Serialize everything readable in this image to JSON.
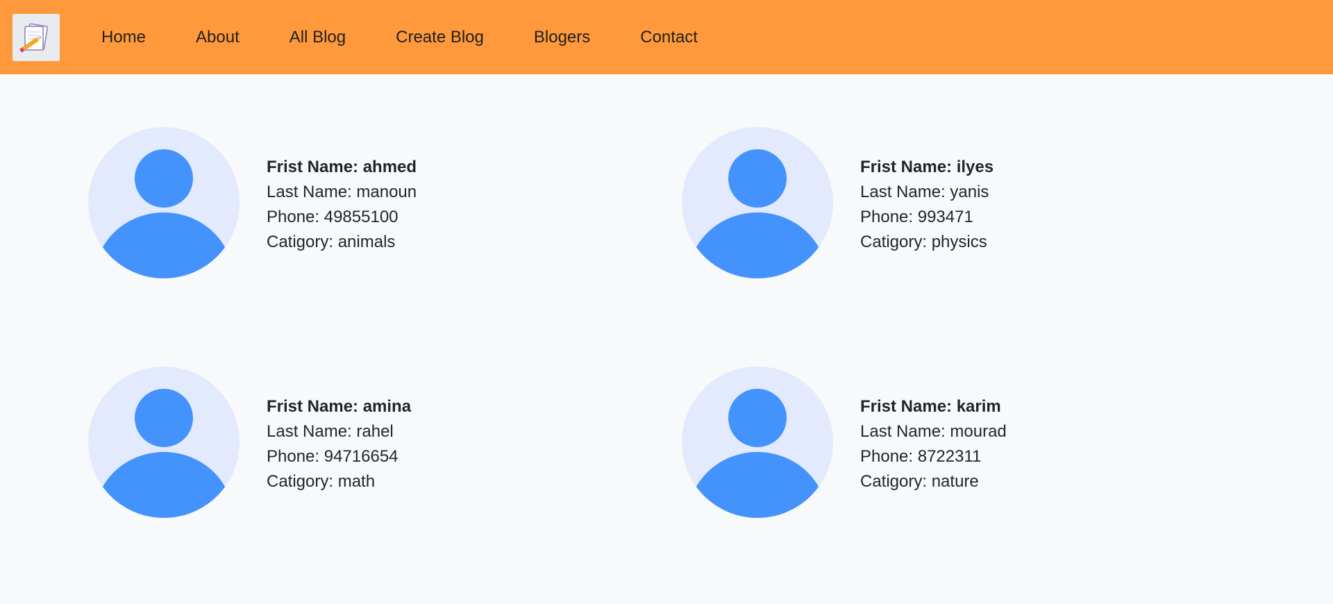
{
  "nav": {
    "logo_icon": "notepad-pencil-icon",
    "links": [
      "Home",
      "About",
      "All Blog",
      "Create Blog",
      "Blogers",
      "Contact"
    ]
  },
  "colors": {
    "navbar": "#ff993b",
    "avatar_bg": "#e3eafd",
    "avatar_fg": "#4493fd",
    "page_bg": "#f8f9fa"
  },
  "bloggers": [
    {
      "first": "Frist Name: ahmed",
      "last": "Last Name: manoun",
      "phone": "Phone: 49855100",
      "category": "Catigory: animals",
      "avatar_icon": "user-avatar-icon"
    },
    {
      "first": "Frist Name: ilyes",
      "last": "Last Name: yanis",
      "phone": "Phone: 993471",
      "category": "Catigory: physics",
      "avatar_icon": "user-avatar-icon"
    },
    {
      "first": "Frist Name: amina",
      "last": "Last Name: rahel",
      "phone": "Phone: 94716654",
      "category": "Catigory: math",
      "avatar_icon": "user-avatar-icon"
    },
    {
      "first": "Frist Name: karim",
      "last": "Last Name: mourad",
      "phone": "Phone: 8722311",
      "category": "Catigory: nature",
      "avatar_icon": "user-avatar-icon"
    }
  ]
}
